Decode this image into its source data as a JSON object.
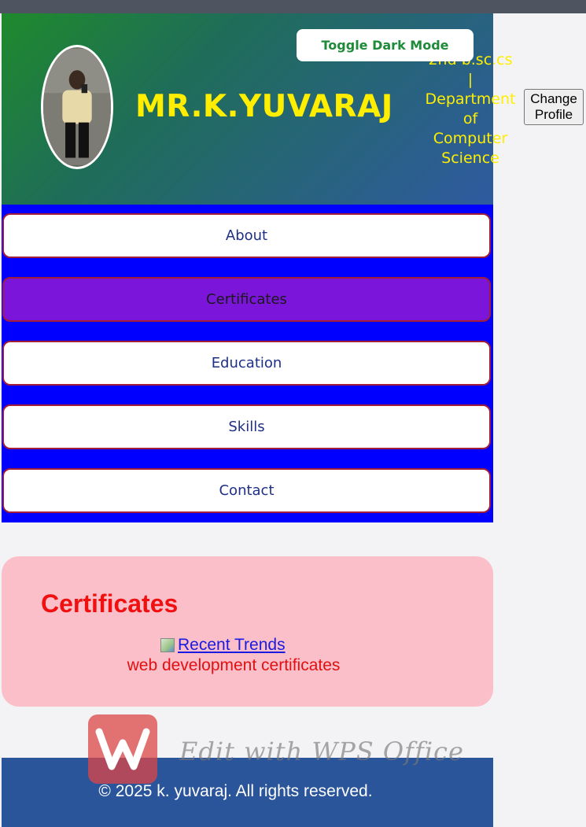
{
  "header": {
    "title": "MR.K.YUVARAJ",
    "toggle_label": "Toggle Dark Mode",
    "subtitle_lines": [
      "2nd b.sc.cs",
      "|",
      "Department",
      "of",
      "Computer",
      "Science"
    ],
    "change_profile_line1": "Change",
    "change_profile_line2": "Profile"
  },
  "nav": {
    "items": [
      {
        "label": "About"
      },
      {
        "label": "Certificates"
      },
      {
        "label": "Education"
      },
      {
        "label": "Skills"
      },
      {
        "label": "Contact"
      }
    ],
    "active_index": 1
  },
  "certificates": {
    "heading": "Certificates",
    "image_alt": "Recent Trends",
    "description": "web development certificates"
  },
  "footer": {
    "copyright": "© 2025 k. yuvaraj. All rights reserved."
  },
  "watermark": {
    "text": "Edit with WPS Office"
  },
  "colors": {
    "title": "#ffee00",
    "nav_background": "#0000ff",
    "nav_active": "#7b15d9",
    "card_background": "#fbbfca",
    "footer_background": "#2b559b"
  }
}
